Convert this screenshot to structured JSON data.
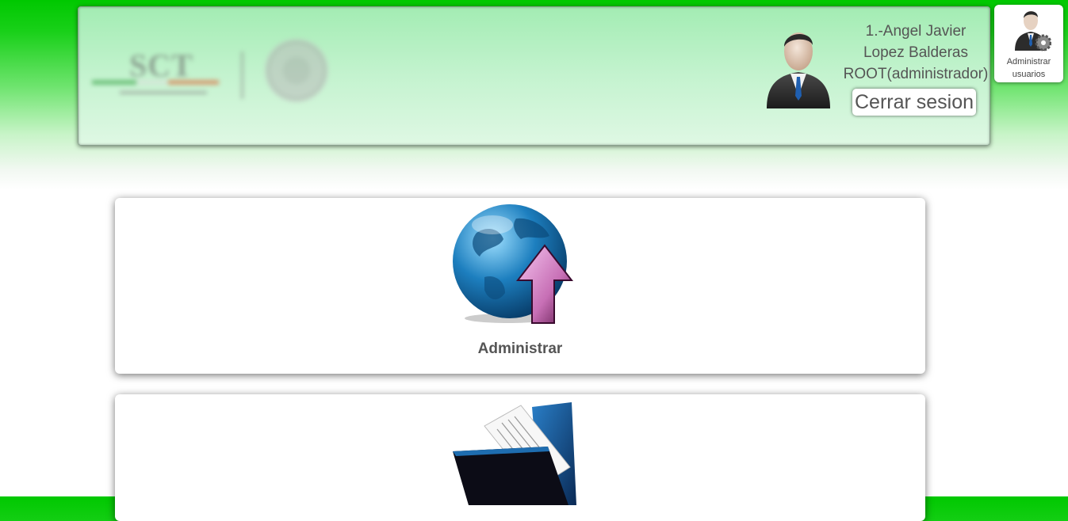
{
  "header": {
    "user": {
      "line1": "1.-Angel Javier",
      "line2": "Lopez Balderas",
      "role": "ROOT(administrador)"
    },
    "logout_label": "Cerrar sesion",
    "logo_text": "SCT"
  },
  "admin_users": {
    "line1": "Administrar",
    "line2": "usuarios"
  },
  "cards": [
    {
      "label": "Administrar",
      "icon": "globe-upload-icon"
    },
    {
      "label": "",
      "icon": "folder-documents-icon"
    }
  ],
  "colors": {
    "header_green": "#00c800",
    "header_panel": "#c4f3cf",
    "text": "#555555"
  }
}
